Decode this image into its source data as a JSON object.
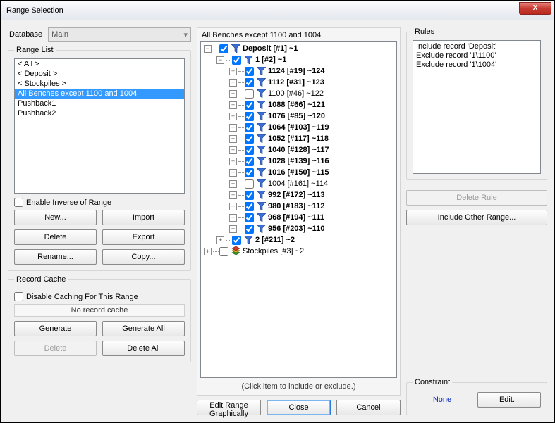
{
  "window": {
    "title": "Range Selection",
    "close": "X"
  },
  "left": {
    "database_label": "Database",
    "database_value": "Main",
    "range_list_legend": "Range List",
    "range_items": [
      {
        "label": "< All >",
        "selected": false
      },
      {
        "label": "< Deposit >",
        "selected": false
      },
      {
        "label": "< Stockpiles >",
        "selected": false
      },
      {
        "label": "All Benches except 1100 and 1004",
        "selected": true
      },
      {
        "label": "Pushback1",
        "selected": false
      },
      {
        "label": "Pushback2",
        "selected": false
      }
    ],
    "inverse_label": "Enable Inverse of Range",
    "buttons": {
      "new": "New...",
      "import": "Import",
      "delete": "Delete",
      "export": "Export",
      "rename": "Rename...",
      "copy": "Copy..."
    },
    "cache_legend": "Record Cache",
    "disable_cache_label": "Disable Caching For This Range",
    "cache_status": "No record cache",
    "cache_buttons": {
      "generate": "Generate",
      "generate_all": "Generate All",
      "delete": "Delete",
      "delete_all": "Delete All"
    }
  },
  "middle": {
    "header": "All Benches except 1100 and 1004",
    "tree": [
      {
        "depth": 0,
        "toggle": "-",
        "checked": true,
        "icon": "funnel",
        "label": "Deposit [#1] ~1",
        "bold": true
      },
      {
        "depth": 1,
        "toggle": "-",
        "checked": true,
        "icon": "funnel",
        "label": "1 [#2] ~1",
        "bold": true
      },
      {
        "depth": 2,
        "toggle": "+",
        "checked": true,
        "icon": "funnel",
        "label": "1124 [#19] ~124",
        "bold": true
      },
      {
        "depth": 2,
        "toggle": "+",
        "checked": true,
        "icon": "funnel",
        "label": "1112 [#31] ~123",
        "bold": true
      },
      {
        "depth": 2,
        "toggle": "+",
        "checked": false,
        "icon": "funnel",
        "label": "1100 [#46] ~122",
        "bold": false
      },
      {
        "depth": 2,
        "toggle": "+",
        "checked": true,
        "icon": "funnel",
        "label": "1088 [#66] ~121",
        "bold": true
      },
      {
        "depth": 2,
        "toggle": "+",
        "checked": true,
        "icon": "funnel",
        "label": "1076 [#85] ~120",
        "bold": true
      },
      {
        "depth": 2,
        "toggle": "+",
        "checked": true,
        "icon": "funnel",
        "label": "1064 [#103] ~119",
        "bold": true
      },
      {
        "depth": 2,
        "toggle": "+",
        "checked": true,
        "icon": "funnel",
        "label": "1052 [#117] ~118",
        "bold": true
      },
      {
        "depth": 2,
        "toggle": "+",
        "checked": true,
        "icon": "funnel",
        "label": "1040 [#128] ~117",
        "bold": true
      },
      {
        "depth": 2,
        "toggle": "+",
        "checked": true,
        "icon": "funnel",
        "label": "1028 [#139] ~116",
        "bold": true
      },
      {
        "depth": 2,
        "toggle": "+",
        "checked": true,
        "icon": "funnel",
        "label": "1016 [#150] ~115",
        "bold": true
      },
      {
        "depth": 2,
        "toggle": "+",
        "checked": false,
        "icon": "funnel",
        "label": "1004 [#161] ~114",
        "bold": false
      },
      {
        "depth": 2,
        "toggle": "+",
        "checked": true,
        "icon": "funnel",
        "label": "992 [#172] ~113",
        "bold": true
      },
      {
        "depth": 2,
        "toggle": "+",
        "checked": true,
        "icon": "funnel",
        "label": "980 [#183] ~112",
        "bold": true
      },
      {
        "depth": 2,
        "toggle": "+",
        "checked": true,
        "icon": "funnel",
        "label": "968 [#194] ~111",
        "bold": true
      },
      {
        "depth": 2,
        "toggle": "+",
        "checked": true,
        "icon": "funnel",
        "label": "956 [#203] ~110",
        "bold": true
      },
      {
        "depth": 1,
        "toggle": "+",
        "checked": true,
        "icon": "funnel",
        "label": "2 [#211] ~2",
        "bold": true
      },
      {
        "depth": 0,
        "toggle": "+",
        "checked": false,
        "icon": "stack",
        "label": "Stockpiles [#3] ~2",
        "bold": false
      }
    ],
    "hint": "(Click item to include or exclude.)",
    "edit_graph": "Edit Range Graphically",
    "close": "Close",
    "cancel": "Cancel"
  },
  "right": {
    "rules_legend": "Rules",
    "rules": [
      "Include  record 'Deposit'",
      "Exclude  record '1\\1100'",
      "Exclude  record '1\\1004'"
    ],
    "delete_rule": "Delete Rule",
    "include_other": "Include Other Range...",
    "constraint_legend": "Constraint",
    "constraint_value": "None",
    "constraint_edit": "Edit..."
  }
}
